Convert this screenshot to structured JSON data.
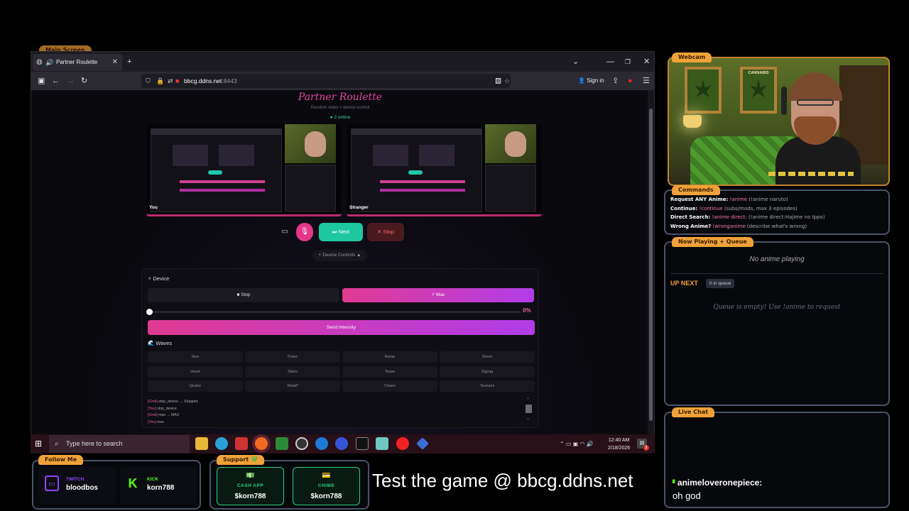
{
  "overlay": {
    "hidden_tag": "Main Screen",
    "webcam_tag": "Webcam",
    "commands_tag": "Commands",
    "queue_tag": "Now Playing + Queue",
    "chat_tag": "Live Chat",
    "follow_tag": "Follow Me",
    "support_tag": "Support 💚",
    "promo": "Test the game @ bbcg.ddns.net"
  },
  "browser": {
    "tab_title": "Partner Roulette",
    "url_host": "bbcg.ddns.net",
    "url_port": ":8443",
    "sign_in": "Sign in"
  },
  "page": {
    "title": "Partner Roulette",
    "subtitle": "Random video + device control",
    "online": "● 2 online",
    "video_you": "You",
    "video_stranger": "Stranger",
    "next_label": "⏭ Next",
    "stop_label": "✕ Stop",
    "device_controls": "⚡ Device Controls ▲",
    "device_heading": "⚡ Device",
    "device_stop": "■ Stop",
    "device_max": "⚡ Max",
    "intensity": 0,
    "percent_label": "0%",
    "send_label": "Send Intensity",
    "waves_heading": "🌊 Waves",
    "waves": [
      "Sine",
      "Pulse",
      "Ramp",
      "Storm",
      "Heart",
      "Stairs",
      "Tease",
      "Zigzag",
      "Quake",
      "SlowP",
      "Chaos",
      "Tsunami"
    ],
    "log": [
      {
        "tag": "[Cmd]",
        "text": " stop_device → Stopped"
      },
      {
        "tag": "[You]",
        "text": " stop_device"
      },
      {
        "tag": "[Cmd]",
        "text": " max → MAX"
      },
      {
        "tag": "[You]",
        "text": " max"
      }
    ]
  },
  "taskbar": {
    "search_placeholder": "Type here to search",
    "time": "12:40 AM",
    "date": "2/18/2026",
    "notifications": "3"
  },
  "commands": [
    {
      "label": "Request ANY Anime:",
      "cmd": "!anime",
      "desc": "(!anime naruto)"
    },
    {
      "label": "Continue:",
      "cmd": "!continue",
      "desc": "(subs/mods, max 3 episodes)"
    },
    {
      "label": "Direct Search:",
      "cmd": "!anime direct:",
      "desc": "(!anime direct:Hajime no Ippo)"
    },
    {
      "label": "Wrong Anime?",
      "cmd": "!wronganime",
      "desc": "(describe what's wrong)"
    }
  ],
  "queue": {
    "now_playing": "No anime playing",
    "up_next": "UP NEXT",
    "count": "0 in queue",
    "empty": "Queue is empty! Use !anime to request"
  },
  "chat": {
    "username": "animeloveronepiece:",
    "message": "oh god"
  },
  "follow": [
    {
      "platform": "TWITCH",
      "user": "bloodbos",
      "color": "#9146ff"
    },
    {
      "platform": "KICK",
      "user": "korn788",
      "color": "#53fc18"
    }
  ],
  "support": [
    {
      "icon": "💵",
      "platform": "CASH APP",
      "handle": "$korn788"
    },
    {
      "icon": "💳",
      "platform": "CHIME",
      "handle": "$korn788"
    }
  ],
  "colors": {
    "accent_pink": "#e03a92",
    "accent_purple": "#b13de8",
    "accent_teal": "#1fc7a0",
    "overlay_orange": "#f0a23a"
  },
  "webcam_posters": [
    "",
    "CANNABIS"
  ]
}
